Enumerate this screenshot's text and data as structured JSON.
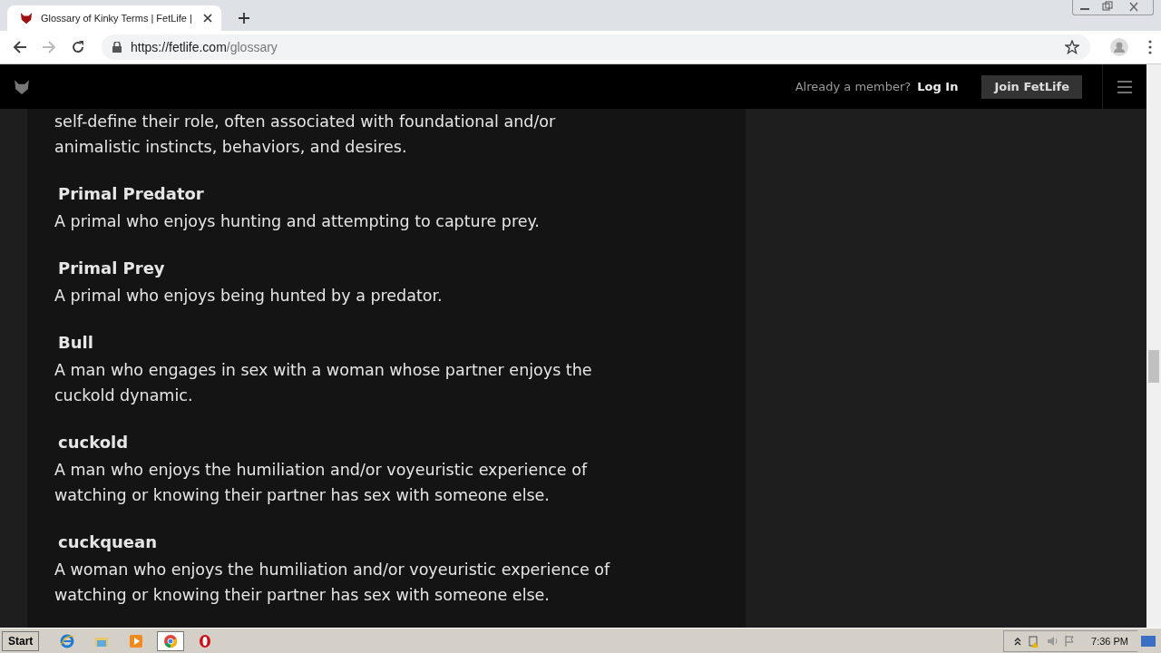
{
  "browser": {
    "tab": {
      "title": "Glossary of Kinky Terms | FetLife |",
      "selected": true
    },
    "url": {
      "host": "https://fetlife.com",
      "path": "/glossary"
    }
  },
  "header": {
    "prompt": "Already a member?",
    "login": "Log In",
    "join": "Join FetLife"
  },
  "glossary": {
    "lead_text": [
      "self-define their role, often associated with foundational and/or",
      "animalistic instincts, behaviors, and desires."
    ],
    "entries": [
      {
        "term": "Primal Predator",
        "definition": "A primal who enjoys hunting and attempting to capture prey."
      },
      {
        "term": "Primal Prey",
        "definition": "A primal who enjoys being hunted by a predator."
      },
      {
        "term": "Bull",
        "definition": "A man who engages in sex with a woman whose partner enjoys the cuckold dynamic."
      },
      {
        "term": "cuckold",
        "definition": "A man who enjoys the humiliation and/or voyeuristic experience of watching or knowing their partner has sex with someone else."
      },
      {
        "term": "cuckquean",
        "definition": "A woman who enjoys the humiliation and/or voyeuristic experience of watching or knowing their partner has sex with someone else."
      }
    ]
  },
  "taskbar": {
    "start": "Start",
    "apps": [
      {
        "kind": "ie",
        "selected": false
      },
      {
        "kind": "folder",
        "selected": false
      },
      {
        "kind": "media",
        "selected": false
      },
      {
        "kind": "chrome",
        "selected": true
      },
      {
        "kind": "opera",
        "selected": false
      }
    ],
    "clock": "7:36 PM"
  }
}
